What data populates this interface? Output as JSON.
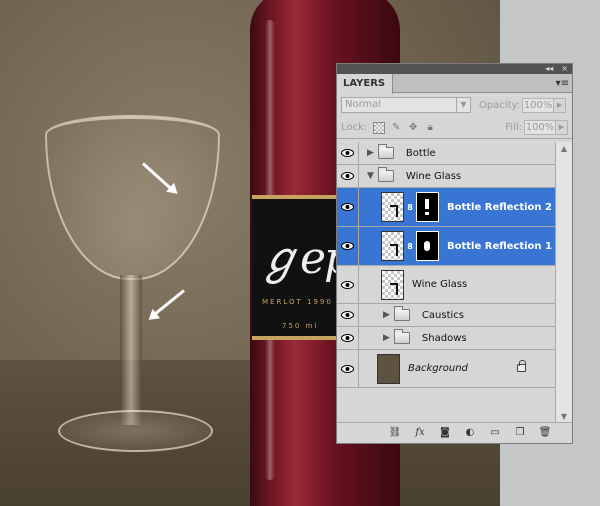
{
  "panel": {
    "tab_label": "LAYERS",
    "titlebar_collapse": "◂◂",
    "titlebar_close": "×",
    "menu_icon": "panel-menu-icon",
    "blend_mode": "Normal",
    "opacity_label": "Opacity:",
    "opacity_value": "100%",
    "lock_label": "Lock:",
    "fill_label": "Fill:",
    "fill_value": "100%"
  },
  "layers": [
    {
      "name": "Bottle",
      "type": "group",
      "expanded": false,
      "indent": 0
    },
    {
      "name": "Wine Glass",
      "type": "group",
      "expanded": true,
      "indent": 0
    },
    {
      "name": "Bottle Reflection 2",
      "type": "layer-with-mask",
      "selected": true
    },
    {
      "name": "Bottle Reflection 1",
      "type": "layer-with-mask",
      "selected": true
    },
    {
      "name": "Wine Glass",
      "type": "layer"
    },
    {
      "name": "Caustics",
      "type": "group",
      "expanded": false,
      "indent": 1
    },
    {
      "name": "Shadows",
      "type": "group",
      "expanded": false,
      "indent": 1
    },
    {
      "name": "Background",
      "type": "background",
      "locked": true
    }
  ],
  "footer": {
    "link": "link-layers-icon",
    "fx": "fx",
    "mask": "add-mask-icon",
    "adjust": "adjustment-layer-icon",
    "group": "new-group-icon",
    "new": "new-layer-icon",
    "trash": "trash-icon"
  },
  "scene": {
    "label_script": "ℊep",
    "label_line1": "MERLOT 1990",
    "label_line2": "750 ml"
  },
  "colors": {
    "selection": "#3975d2",
    "panel_bg": "#d6d6d6",
    "titlebar": "#535353"
  }
}
